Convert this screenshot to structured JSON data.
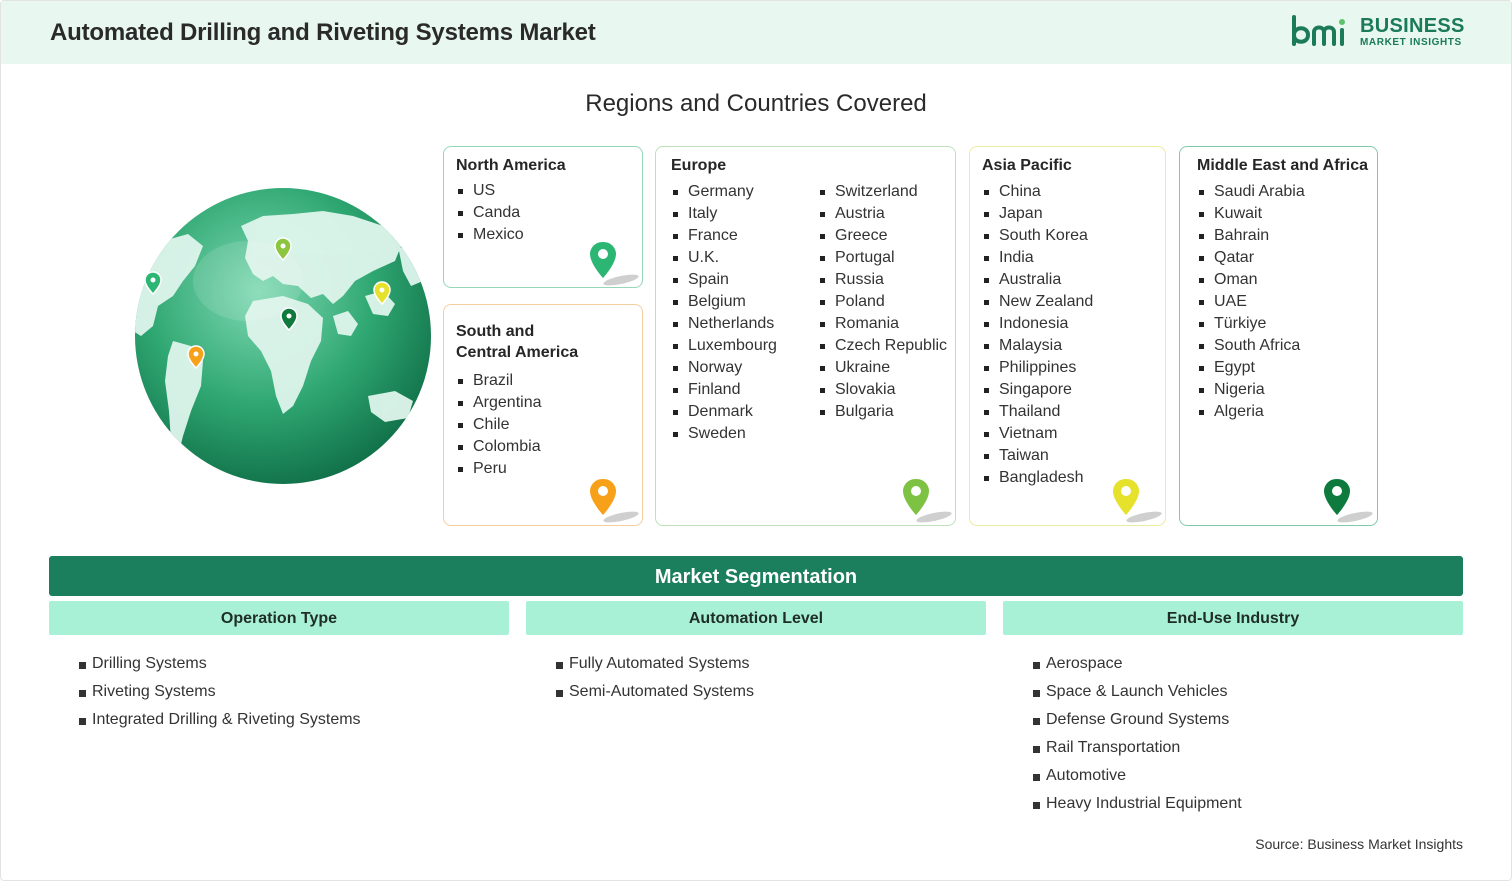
{
  "header": {
    "title": "Automated Drilling and Riveting Systems Market",
    "logo_line1": "BUSINESS",
    "logo_line2": "MARKET INSIGHTS"
  },
  "regions": {
    "title": "Regions and Countries Covered",
    "north_america": {
      "name": "North America",
      "countries": [
        "US",
        "Canda",
        "Mexico"
      ],
      "pin_color": "#2bb673"
    },
    "south_central_america": {
      "name_line1": "South and",
      "name_line2": "Central America",
      "countries": [
        "Brazil",
        "Argentina",
        "Chile",
        "Colombia",
        "Peru"
      ],
      "pin_color": "#f7a11a"
    },
    "europe": {
      "name": "Europe",
      "countries_col1": [
        "Germany",
        "Italy",
        "France",
        "U.K.",
        "Spain",
        "Belgium",
        "Netherlands",
        "Luxembourg",
        "Norway",
        "Finland",
        "Denmark",
        "Sweden"
      ],
      "countries_col2": [
        "Switzerland",
        "Austria",
        "Greece",
        "Portugal",
        "Russia",
        "Poland",
        "Romania",
        "Czech Republic",
        "Ukraine",
        "Slovakia",
        "Bulgaria"
      ],
      "pin_color": "#7dc242"
    },
    "asia_pacific": {
      "name": "Asia Pacific",
      "countries": [
        "China",
        "Japan",
        "South Korea",
        "India",
        "Australia",
        "New Zealand",
        "Indonesia",
        "Malaysia",
        "Philippines",
        "Singapore",
        "Thailand",
        "Vietnam",
        "Taiwan",
        "Bangladesh"
      ],
      "pin_color": "#e6e12b"
    },
    "middle_east_africa": {
      "name": "Middle East and Africa",
      "countries": [
        "Saudi Arabia",
        "Kuwait",
        "Bahrain",
        "Qatar",
        "Oman",
        "UAE",
        "Türkiye",
        "South Africa",
        "Egypt",
        "Nigeria",
        "Algeria"
      ],
      "pin_color": "#0f7a3d"
    }
  },
  "segmentation": {
    "title": "Market Segmentation",
    "operation_type": {
      "heading": "Operation Type",
      "items": [
        "Drilling Systems",
        "Riveting Systems",
        "Integrated Drilling & Riveting Systems"
      ]
    },
    "automation_level": {
      "heading": "Automation Level",
      "items": [
        "Fully Automated Systems",
        "Semi-Automated Systems"
      ]
    },
    "end_use_industry": {
      "heading": "End-Use Industry",
      "items": [
        "Aerospace",
        "Space & Launch Vehicles",
        "Defense Ground Systems",
        "Rail Transportation",
        "Automotive",
        "Heavy Industrial Equipment"
      ]
    }
  },
  "footer": {
    "source": "Source: Business Market Insights"
  }
}
